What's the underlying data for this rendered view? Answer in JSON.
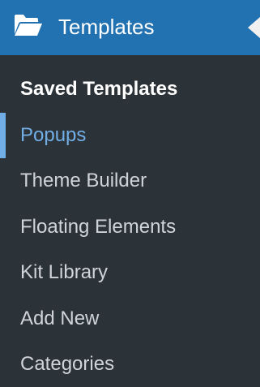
{
  "menu": {
    "title": "Templates",
    "icon": "folder-open-icon",
    "accent_color": "#2271b1",
    "active_color": "#72aee6",
    "items": [
      {
        "label": "Saved Templates"
      },
      {
        "label": "Popups"
      },
      {
        "label": "Theme Builder"
      },
      {
        "label": "Floating Elements"
      },
      {
        "label": "Kit Library"
      },
      {
        "label": "Add New"
      },
      {
        "label": "Categories"
      }
    ]
  }
}
